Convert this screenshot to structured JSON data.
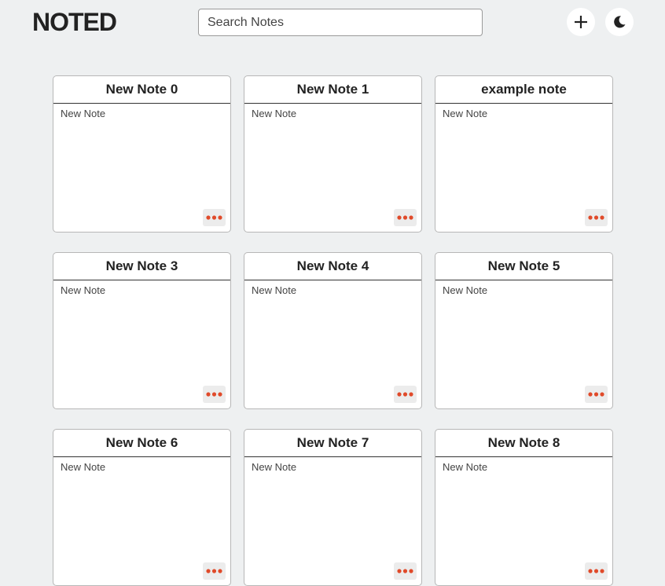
{
  "header": {
    "logo": "NOTED",
    "search_placeholder": "Search Notes",
    "add_icon": "plus-icon",
    "theme_icon": "moon-icon"
  },
  "colors": {
    "menu_dots": "#e04a2a",
    "background": "#eef0f1"
  },
  "notes": [
    {
      "title": "New Note 0",
      "body": "New Note"
    },
    {
      "title": "New Note 1",
      "body": "New Note"
    },
    {
      "title": "example note",
      "body": "New Note"
    },
    {
      "title": "New Note 3",
      "body": "New Note"
    },
    {
      "title": "New Note 4",
      "body": "New Note"
    },
    {
      "title": "New Note 5",
      "body": "New Note"
    },
    {
      "title": "New Note 6",
      "body": "New Note"
    },
    {
      "title": "New Note 7",
      "body": "New Note"
    },
    {
      "title": "New Note 8",
      "body": "New Note"
    }
  ]
}
